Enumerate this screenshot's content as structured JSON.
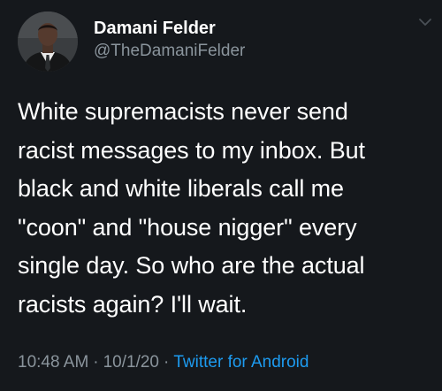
{
  "tweet": {
    "author": {
      "name": "Damani Felder",
      "handle": "@TheDamaniFelder"
    },
    "text": "White supremacists never send\nracist messages to my inbox. But\nblack and white liberals call me\n\"coon\" and \"house nigger\" every\nsingle day. So who are the actual\nracists again? I'll wait.",
    "time": "10:48 AM",
    "separator": "·",
    "date": "10/1/20",
    "source": "Twitter for Android"
  },
  "icons": {
    "avatar": "profile-photo",
    "menu": "chevron-down-icon"
  },
  "colors": {
    "background": "#15181c",
    "primary_text": "#ffffff",
    "secondary_text": "#8a949c",
    "link": "#1d9bf0"
  }
}
